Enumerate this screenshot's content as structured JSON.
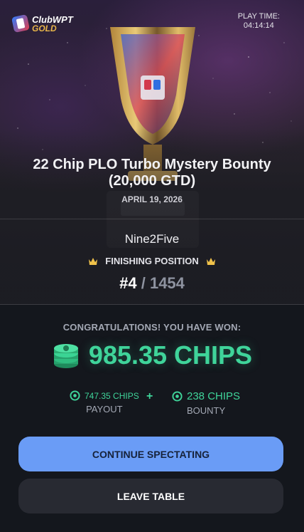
{
  "brand": {
    "name": "ClubWPT",
    "tier": "GOLD"
  },
  "play_time": {
    "label": "PLAY TIME:",
    "value": "04:14:14"
  },
  "tournament": {
    "title": "22 Chip PLO Turbo Mystery Bounty (20,000 GTD)",
    "date": "APRIL 19, 2026"
  },
  "player": {
    "name": "Nine2Five"
  },
  "finishing": {
    "label": "FINISHING POSITION",
    "rank": "#4",
    "separator": "/",
    "total": "1454"
  },
  "winnings": {
    "headline": "CONGRATULATIONS! YOU HAVE WON:",
    "total": "985.35 CHIPS",
    "payout": {
      "value": "747.35 CHIPS",
      "label": "PAYOUT"
    },
    "plus": "+",
    "bounty": {
      "value": "238 CHIPS",
      "label": "BOUNTY"
    }
  },
  "buttons": {
    "continue": "CONTINUE SPECTATING",
    "leave": "LEAVE TABLE"
  },
  "colors": {
    "accent_green": "#3fd49a",
    "primary_button": "#6a9cf6",
    "secondary_button": "#282a32",
    "background": "#14171d"
  },
  "icons": {
    "logo": "clubwpt-logo-icon",
    "crown": "crown-icon",
    "chips": "chip-stack-icon",
    "chip": "chip-icon",
    "trophy": "trophy-image"
  }
}
